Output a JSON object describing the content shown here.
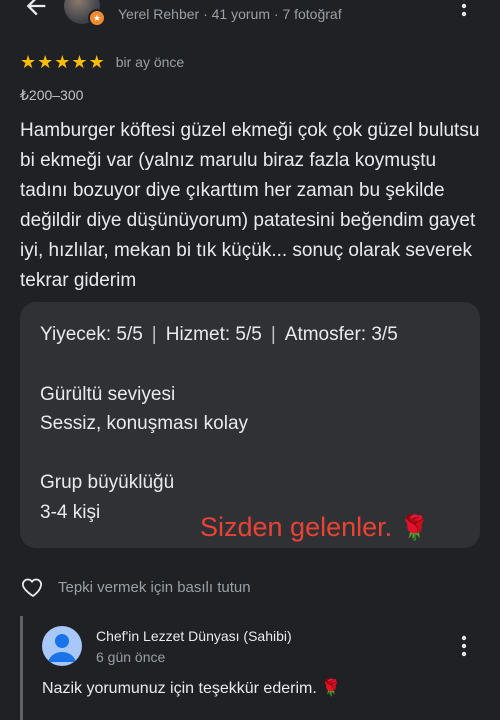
{
  "reviewer": {
    "meta": "Yerel Rehber · 41 yorum · 7 fotoğraf"
  },
  "review": {
    "stars": 5,
    "time_ago": "bir ay önce",
    "price": "₺200–300",
    "text": "Hamburger köftesi güzel ekmeği çok çok güzel bulutsu bi ekmeği var (yalnız marulu biraz fazla koymuştu tadını bozuyor diye çıkarttım her zaman bu şekilde değildir diye düşünüyorum) patatesini beğendim gayet iyi, hızlılar, mekan bi tık küçük... sonuç olarak severek tekrar giderim"
  },
  "details": {
    "food": "Yiyecek: 5/5",
    "service": "Hizmet: 5/5",
    "atmosphere": "Atmosfer: 3/5",
    "separator": "|",
    "noise_label": "Gürültü seviyesi",
    "noise_value": "Sessiz, konuşması kolay",
    "group_label": "Grup büyüklüğü",
    "group_value": "3-4 kişi"
  },
  "overlay": {
    "text": "Sizden gelenler.",
    "emoji": "🌹"
  },
  "reaction": {
    "hint": "Tepki vermek için basılı tutun"
  },
  "owner_response": {
    "name": "Chef'in Lezzet Dünyası (Sahibi)",
    "time_ago": "6 gün önce",
    "text": "Nazik yorumunuz için teşekkür ederim. 🌹"
  },
  "colors": {
    "background": "#202124",
    "card": "#303134",
    "star": "#fbbc04",
    "overlay_text": "#ea4335",
    "owner_avatar": "#a8c7fa"
  }
}
